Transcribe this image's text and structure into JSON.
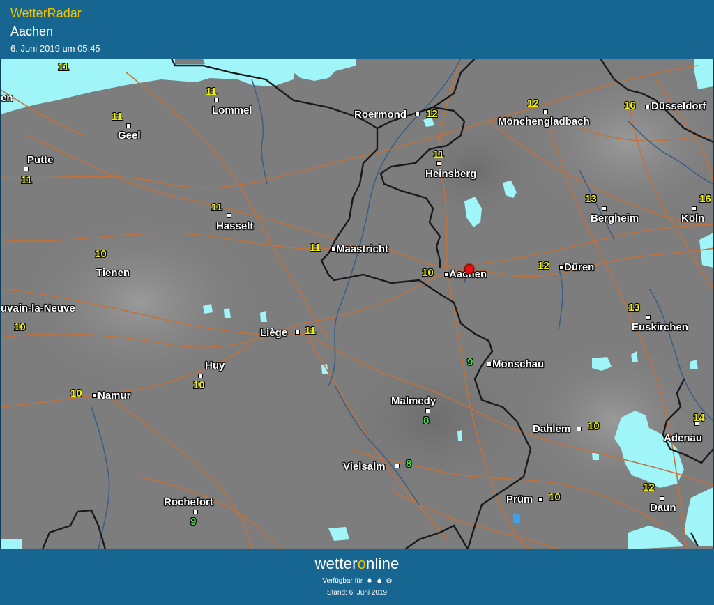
{
  "header": {
    "app_title": "WetterRadar",
    "location": "Aachen",
    "timestamp": "6. Juni 2019 um 05:45"
  },
  "footer": {
    "logo_prefix": "wetter",
    "logo_o": "o",
    "logo_suffix": "nline",
    "availability": "Verfügbar für",
    "stand": "Stand: 6. Juni 2019",
    "platform_icons": [
      "android-icon",
      "apple-icon",
      "web-icon"
    ]
  },
  "colors": {
    "header_bg": "#176591",
    "title_accent": "#f2c200",
    "map_bg": "#7d7d7d",
    "precip": "#9ff5f8",
    "roads": "#c2713a",
    "temp_warm": "#eef000",
    "temp_cool": "#3fe83f"
  },
  "cities": [
    {
      "name": "Roermond"
    },
    {
      "name": "Mönchengladbach"
    },
    {
      "name": "Düsseldorf"
    },
    {
      "name": "Lommel"
    },
    {
      "name": "Geel"
    },
    {
      "name": "Putte"
    },
    {
      "name": "Heinsberg"
    },
    {
      "name": "Hasselt"
    },
    {
      "name": "Maastricht"
    },
    {
      "name": "Bergheim"
    },
    {
      "name": "Köln"
    },
    {
      "name": "Tienen"
    },
    {
      "name": "Aachen"
    },
    {
      "name": "Düren"
    },
    {
      "name": "Euskirchen"
    },
    {
      "name": "uvain-la-Neuve"
    },
    {
      "name": "Liège"
    },
    {
      "name": "Monschau"
    },
    {
      "name": "Huy"
    },
    {
      "name": "Namur"
    },
    {
      "name": "Malmedy"
    },
    {
      "name": "Dahlem"
    },
    {
      "name": "Adenau"
    },
    {
      "name": "Vielsalm"
    },
    {
      "name": "Prüm"
    },
    {
      "name": "Daun"
    },
    {
      "name": "Rochefort"
    },
    {
      "name": "en"
    }
  ],
  "temperatures": [
    {
      "value": "11"
    },
    {
      "value": "11"
    },
    {
      "value": "11"
    },
    {
      "value": "12"
    },
    {
      "value": "12"
    },
    {
      "value": "16"
    },
    {
      "value": "11"
    },
    {
      "value": "11"
    },
    {
      "value": "11"
    },
    {
      "value": "13"
    },
    {
      "value": "16"
    },
    {
      "value": "11"
    },
    {
      "value": "10"
    },
    {
      "value": "10"
    },
    {
      "value": "12"
    },
    {
      "value": "13"
    },
    {
      "value": "10"
    },
    {
      "value": "11"
    },
    {
      "value": "9"
    },
    {
      "value": "10"
    },
    {
      "value": "10"
    },
    {
      "value": "8"
    },
    {
      "value": "10"
    },
    {
      "value": "14"
    },
    {
      "value": "8"
    },
    {
      "value": "10"
    },
    {
      "value": "12"
    },
    {
      "value": "9"
    }
  ]
}
